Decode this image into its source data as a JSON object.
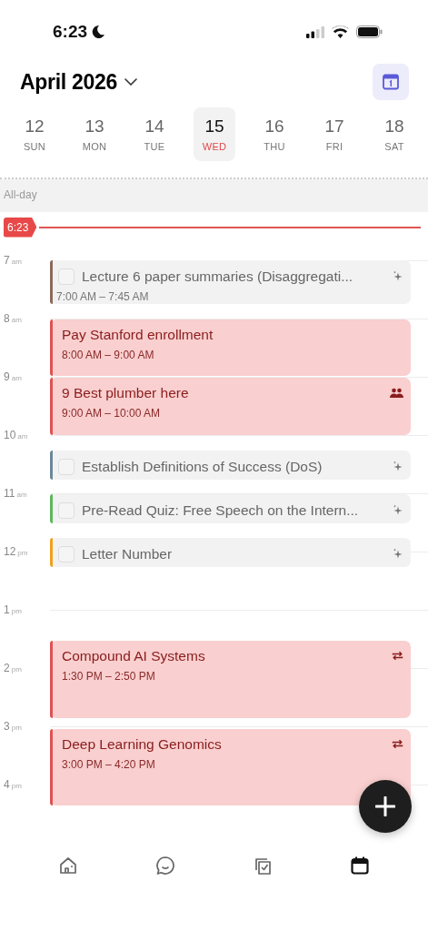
{
  "status_bar": {
    "time": "6:23"
  },
  "header": {
    "title": "April 2026"
  },
  "days": [
    {
      "date": "12",
      "weekday": "SUN",
      "selected": false
    },
    {
      "date": "13",
      "weekday": "MON",
      "selected": false
    },
    {
      "date": "14",
      "weekday": "TUE",
      "selected": false
    },
    {
      "date": "15",
      "weekday": "WED",
      "selected": true
    },
    {
      "date": "16",
      "weekday": "THU",
      "selected": false
    },
    {
      "date": "17",
      "weekday": "FRI",
      "selected": false
    },
    {
      "date": "18",
      "weekday": "SAT",
      "selected": false
    }
  ],
  "all_day": {
    "label": "All-day"
  },
  "now_indicator": {
    "time": "6:23"
  },
  "hours": [
    {
      "hour": "7",
      "period": "am"
    },
    {
      "hour": "8",
      "period": "am"
    },
    {
      "hour": "9",
      "period": "am"
    },
    {
      "hour": "10",
      "period": "am"
    },
    {
      "hour": "11",
      "period": "am"
    },
    {
      "hour": "12",
      "period": "pm"
    },
    {
      "hour": "1",
      "period": "pm"
    },
    {
      "hour": "2",
      "period": "pm"
    },
    {
      "hour": "3",
      "period": "pm"
    },
    {
      "hour": "4",
      "period": "pm"
    }
  ],
  "events": [
    {
      "kind": "task",
      "title": "Lecture 6 paper summaries (Disaggregati...",
      "time": "7:00 AM – 7:45 AM",
      "checked": false,
      "color": "#8b6a5a"
    },
    {
      "kind": "event",
      "title": "Pay Stanford enrollment",
      "time": "8:00 AM – 9:00 AM",
      "color": "#e05252",
      "recurring": false,
      "guests": false
    },
    {
      "kind": "event",
      "title": "9 Best plumber here",
      "time": "9:00 AM – 10:00 AM",
      "color": "#e05252",
      "recurring": false,
      "guests": true
    },
    {
      "kind": "task",
      "title": "Establish Definitions of Success (DoS)",
      "checked": false,
      "color": "#6b8799"
    },
    {
      "kind": "task",
      "title": "Pre-Read Quiz: Free Speech on the Intern...",
      "checked": false,
      "color": "#5cb85c"
    },
    {
      "kind": "task",
      "title": "Letter Number",
      "checked": false,
      "color": "#f0a020"
    },
    {
      "kind": "event",
      "title": "Compound AI Systems",
      "time": "1:30 PM – 2:50 PM",
      "color": "#e05252",
      "recurring": true,
      "guests": false
    },
    {
      "kind": "event",
      "title": "Deep Learning Genomics",
      "time": "3:00 PM – 4:20 PM",
      "color": "#e05252",
      "recurring": true,
      "guests": false
    }
  ],
  "bottom_nav": [
    {
      "kind": "home",
      "selected": false
    },
    {
      "kind": "chat",
      "selected": false
    },
    {
      "kind": "tasks",
      "selected": false
    },
    {
      "kind": "calendar",
      "selected": true
    }
  ]
}
